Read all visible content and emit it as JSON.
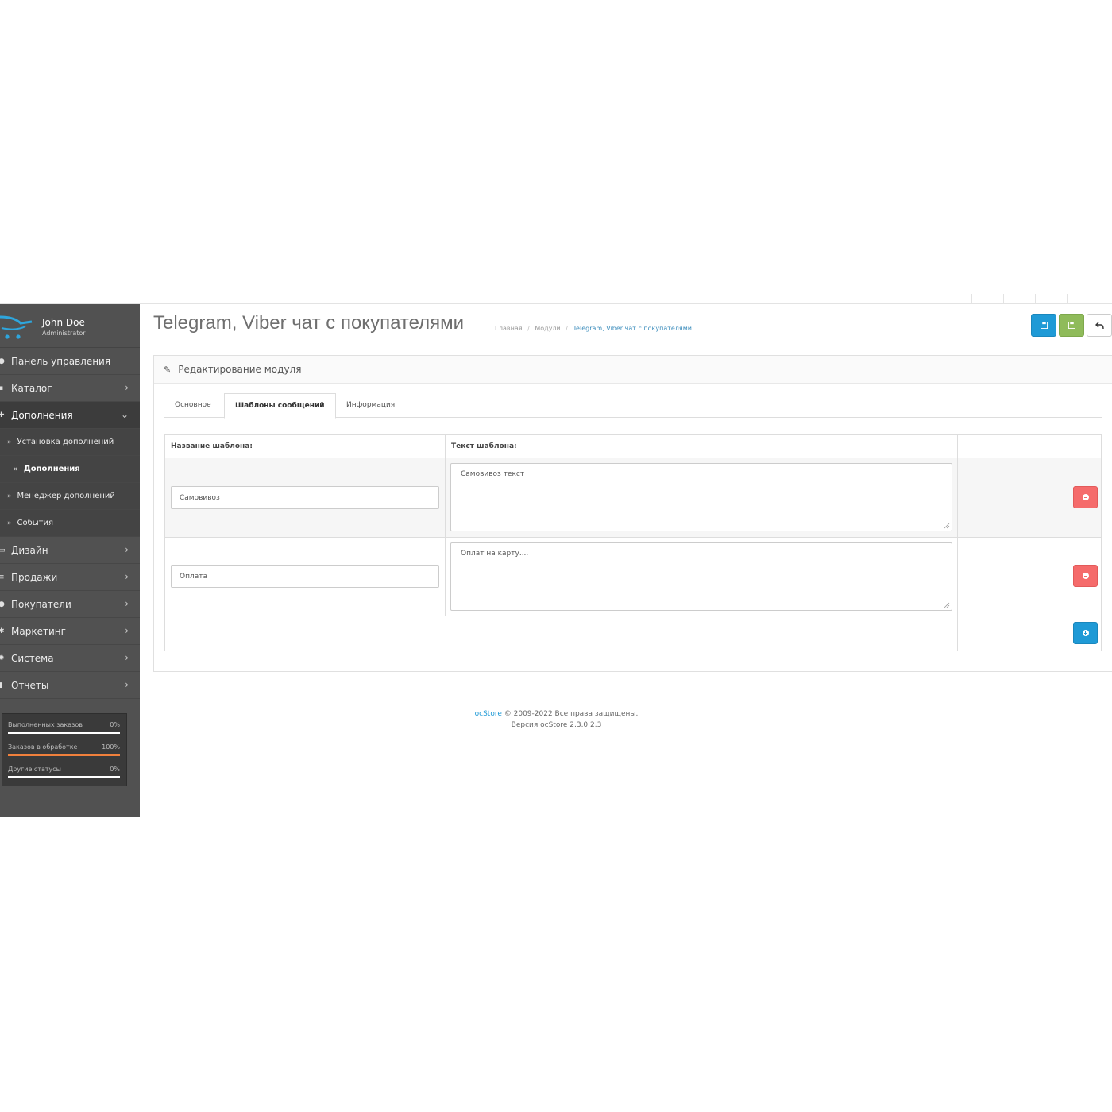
{
  "user": {
    "name": "John Doe",
    "role": "Administrator"
  },
  "sidebar": {
    "items": [
      {
        "label": "Панель управления",
        "icon": "dashboard-icon",
        "glyph": "●"
      },
      {
        "label": "Каталог",
        "icon": "tags-icon",
        "glyph": "▪"
      },
      {
        "label": "Дополнения",
        "icon": "puzzle-icon",
        "glyph": "✚"
      },
      {
        "label": "Установка дополнений"
      },
      {
        "label": "Дополнения"
      },
      {
        "label": "Менеджер дополнений"
      },
      {
        "label": "События"
      },
      {
        "label": "Дизайн",
        "icon": "monitor-icon",
        "glyph": "▭"
      },
      {
        "label": "Продажи",
        "icon": "cart-icon",
        "glyph": "≡"
      },
      {
        "label": "Покупатели",
        "icon": "user-icon",
        "glyph": "●"
      },
      {
        "label": "Маркетинг",
        "icon": "share-icon",
        "glyph": "✱"
      },
      {
        "label": "Система",
        "icon": "cog-icon",
        "glyph": "✹"
      },
      {
        "label": "Отчеты",
        "icon": "bar-chart-icon",
        "glyph": "▮"
      }
    ],
    "chevron_right": "›",
    "chevron_down": "⌄",
    "sub_arrow": "»"
  },
  "stats": [
    {
      "label": "Выполненных заказов",
      "value": "0%",
      "fill": 0
    },
    {
      "label": "Заказов в обработке",
      "value": "100%",
      "fill": 1
    },
    {
      "label": "Другие статусы",
      "value": "0%",
      "fill": 0
    }
  ],
  "header": {
    "title": "Telegram, Viber чат с покупателями",
    "breadcrumb": [
      "Главная",
      "Модули",
      "Telegram, Viber чат с покупателями"
    ],
    "breadcrumb_sep": "/",
    "colors": {
      "save": "#1f9ad6",
      "apply": "#8fbb5a"
    }
  },
  "panel": {
    "title": "Редактирование модуля",
    "pencil": "✎",
    "tabs": [
      "Основное",
      "Шаблоны сообщений",
      "Информация"
    ]
  },
  "templates": {
    "col_name": "Название шаблона:",
    "col_text": "Текст шаблона:",
    "rows": [
      {
        "name": "Самовивоз",
        "text": "Самовивоз текст"
      },
      {
        "name": "Оплата",
        "text": "Оплат на карту...."
      }
    ]
  },
  "footer": {
    "brand": "ocStore",
    "copyright": "© 2009-2022 Все права защищены.",
    "version": "Версия ocStore 2.3.0.2.3"
  }
}
